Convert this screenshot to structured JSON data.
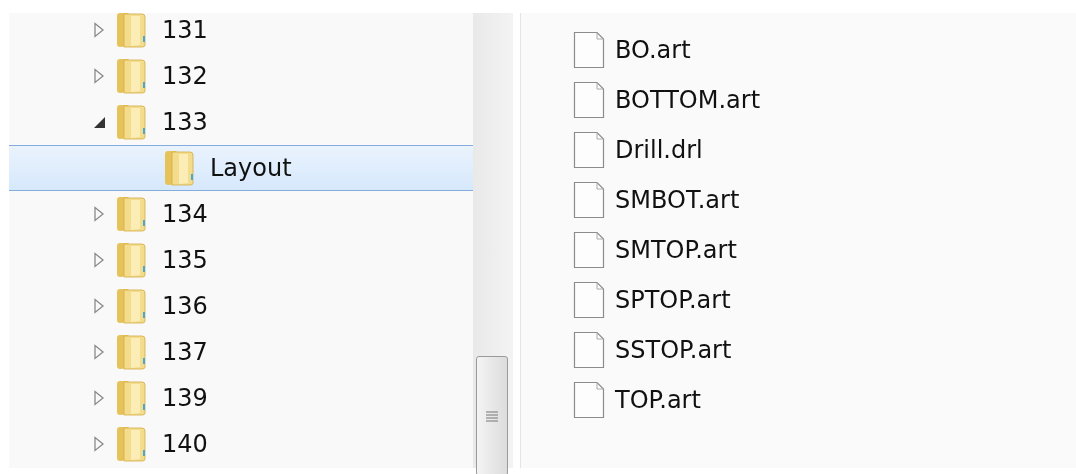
{
  "navigation_tree": {
    "items": [
      {
        "label": "131",
        "expanded": false,
        "selected": false
      },
      {
        "label": "132",
        "expanded": false,
        "selected": false
      },
      {
        "label": "133",
        "expanded": true,
        "selected": false,
        "children": [
          {
            "label": "Layout",
            "selected": true
          }
        ]
      },
      {
        "label": "134",
        "expanded": false,
        "selected": false
      },
      {
        "label": "135",
        "expanded": false,
        "selected": false
      },
      {
        "label": "136",
        "expanded": false,
        "selected": false
      },
      {
        "label": "137",
        "expanded": false,
        "selected": false
      },
      {
        "label": "139",
        "expanded": false,
        "selected": false
      },
      {
        "label": "140",
        "expanded": false,
        "selected": false
      }
    ]
  },
  "file_list": {
    "items": [
      {
        "name": "BO.art"
      },
      {
        "name": "BOTTOM.art"
      },
      {
        "name": "Drill.drl"
      },
      {
        "name": "SMBOT.art"
      },
      {
        "name": "SMTOP.art"
      },
      {
        "name": "SPTOP.art"
      },
      {
        "name": "SSTOP.art"
      },
      {
        "name": "TOP.art"
      }
    ]
  }
}
